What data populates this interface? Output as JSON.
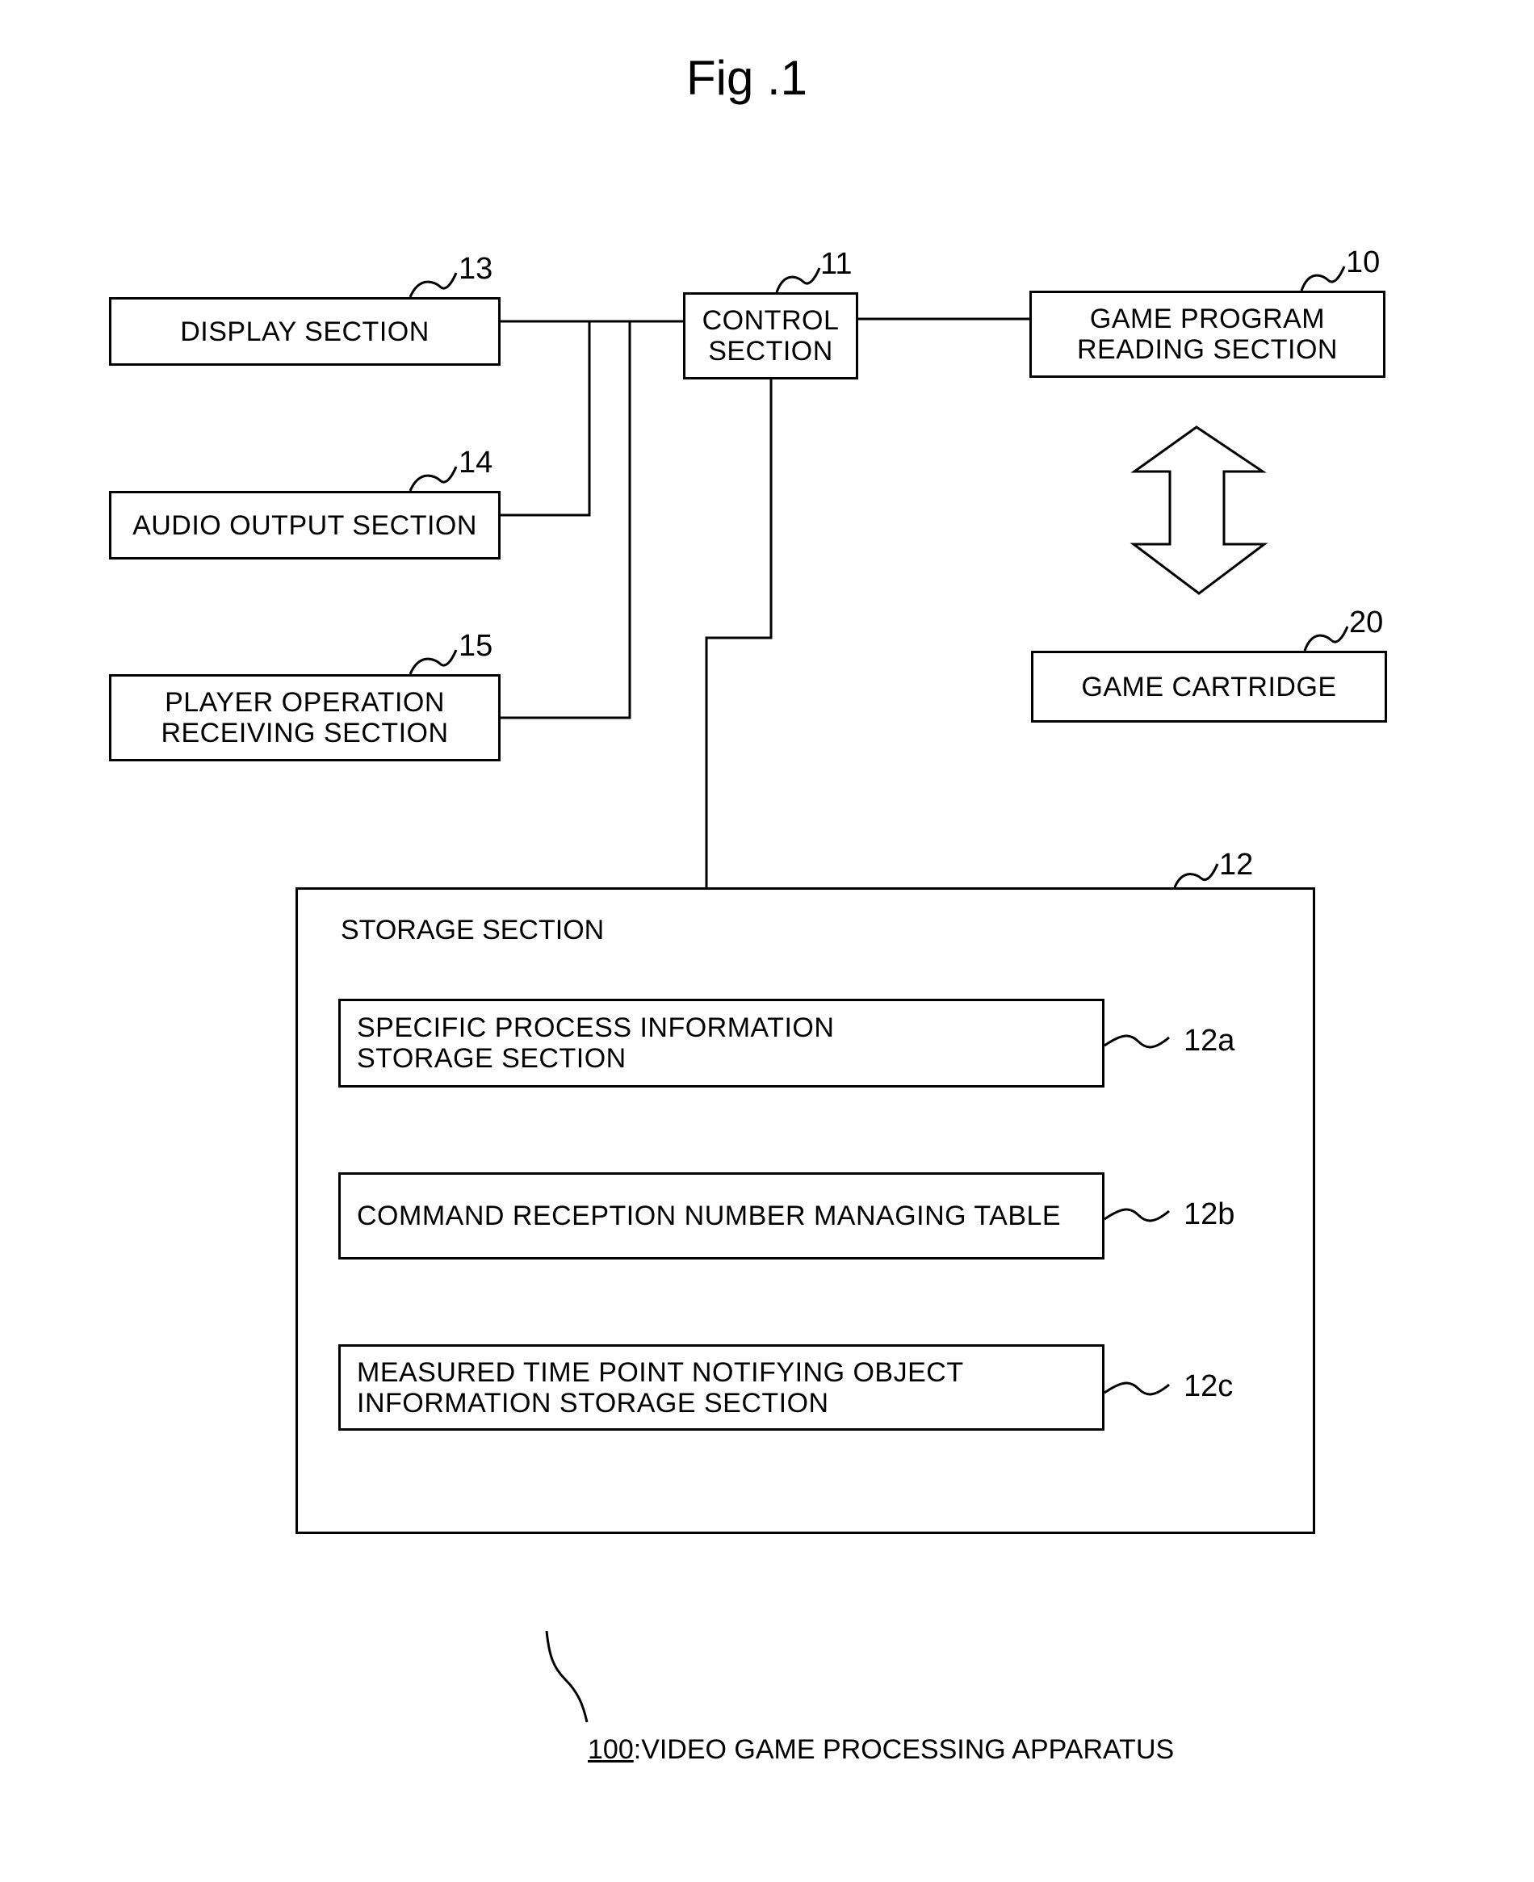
{
  "figure": {
    "title": "Fig .1",
    "caption_number": "100",
    "caption_separator": ":",
    "caption_text": "VIDEO GAME PROCESSING APPARATUS"
  },
  "blocks": {
    "display": {
      "label": "DISPLAY SECTION",
      "ref": "13"
    },
    "control": {
      "label_line1": "CONTROL",
      "label_line2": "SECTION",
      "ref": "11"
    },
    "game_program_reading": {
      "label_line1": "GAME PROGRAM",
      "label_line2": "READING SECTION",
      "ref": "10"
    },
    "audio_output": {
      "label": "AUDIO OUTPUT SECTION",
      "ref": "14"
    },
    "player_operation": {
      "label_line1": "PLAYER OPERATION",
      "label_line2": "RECEIVING SECTION",
      "ref": "15"
    },
    "game_cartridge": {
      "label": "GAME CARTRIDGE",
      "ref": "20"
    },
    "storage": {
      "label": "STORAGE SECTION",
      "ref": "12",
      "sub": [
        {
          "label_line1": "SPECIFIC PROCESS INFORMATION",
          "label_line2": "STORAGE SECTION",
          "ref": "12a"
        },
        {
          "label_line1": "COMMAND RECEPTION NUMBER MANAGING TABLE",
          "label_line2": "",
          "ref": "12b"
        },
        {
          "label_line1": "MEASURED TIME POINT NOTIFYING OBJECT",
          "label_line2": "INFORMATION STORAGE SECTION",
          "ref": "12c"
        }
      ]
    }
  },
  "connections": [
    {
      "from": "display",
      "to": "control"
    },
    {
      "from": "audio_output",
      "to": "control"
    },
    {
      "from": "player_operation",
      "to": "control"
    },
    {
      "from": "control",
      "to": "game_program_reading"
    },
    {
      "from": "control",
      "to": "storage"
    },
    {
      "from": "game_program_reading",
      "to": "game_cartridge",
      "kind": "bidirectional-arrow"
    }
  ]
}
